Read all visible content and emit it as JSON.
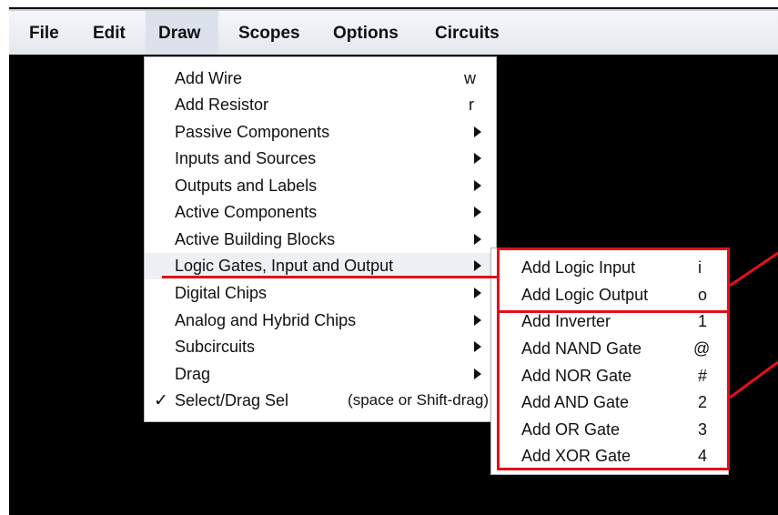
{
  "menubar": {
    "items": [
      {
        "label": "File"
      },
      {
        "label": "Edit"
      },
      {
        "label": "Draw"
      },
      {
        "label": "Scopes"
      },
      {
        "label": "Options"
      },
      {
        "label": "Circuits"
      }
    ],
    "active": "Draw"
  },
  "draw_menu": {
    "items": [
      {
        "label": "Add Wire",
        "shortcut": "w"
      },
      {
        "label": "Add Resistor",
        "shortcut": "r"
      },
      {
        "label": "Passive Components",
        "submenu": true
      },
      {
        "label": "Inputs and Sources",
        "submenu": true
      },
      {
        "label": "Outputs and Labels",
        "submenu": true
      },
      {
        "label": "Active Components",
        "submenu": true
      },
      {
        "label": "Active Building Blocks",
        "submenu": true
      },
      {
        "label": "Logic Gates, Input and Output",
        "submenu": true,
        "highlighted": true
      },
      {
        "label": "Digital Chips",
        "submenu": true
      },
      {
        "label": "Analog and Hybrid Chips",
        "submenu": true
      },
      {
        "label": "Subcircuits",
        "submenu": true
      },
      {
        "label": "Drag",
        "submenu": true
      },
      {
        "label": "Select/Drag Sel",
        "shortcut": "(space or Shift-drag)",
        "checked": true,
        "check_mark": "✓"
      }
    ]
  },
  "logic_submenu": {
    "items": [
      {
        "label": "Add Logic Input",
        "shortcut": "i"
      },
      {
        "label": "Add Logic Output",
        "shortcut": "o"
      },
      {
        "label": "Add Inverter",
        "shortcut": "1"
      },
      {
        "label": "Add NAND Gate",
        "shortcut": "@"
      },
      {
        "label": "Add NOR Gate",
        "shortcut": "#"
      },
      {
        "label": "Add AND Gate",
        "shortcut": "2"
      },
      {
        "label": "Add OR Gate",
        "shortcut": "3"
      },
      {
        "label": "Add XOR Gate",
        "shortcut": "4"
      }
    ]
  },
  "annotation_color": "#e3101a"
}
